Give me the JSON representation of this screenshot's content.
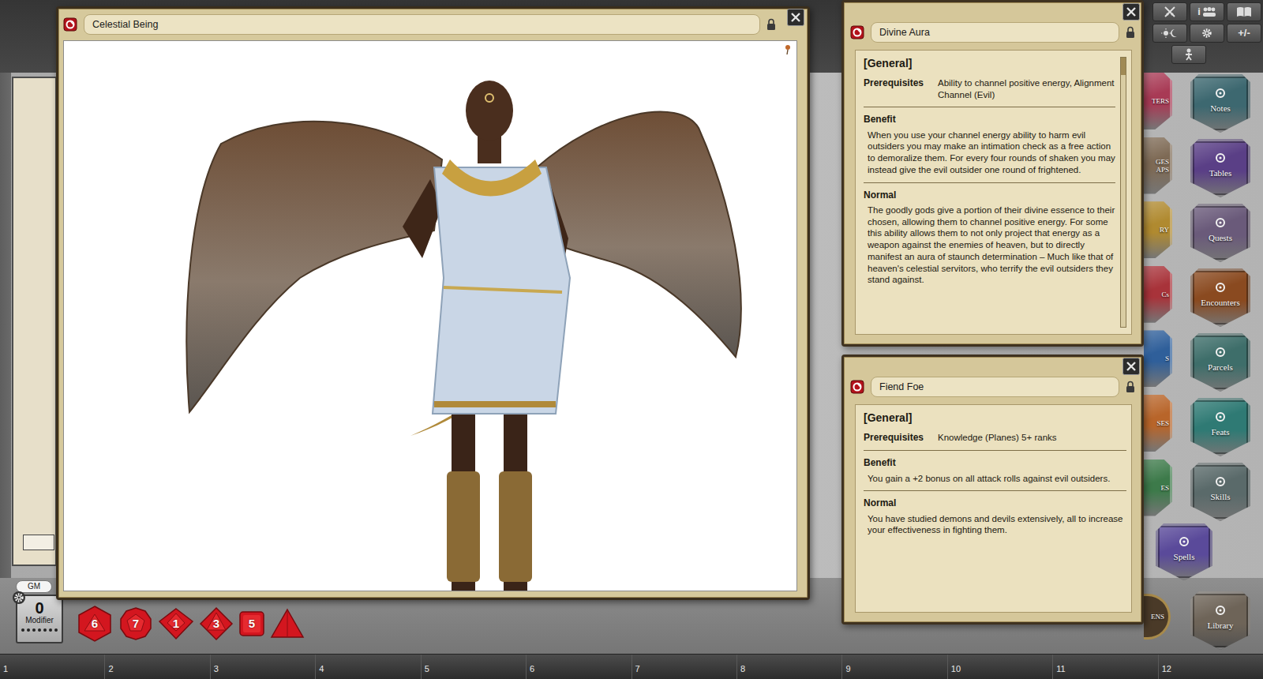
{
  "image_window": {
    "title": "Celestial Being"
  },
  "feat_windows": [
    {
      "title": "Divine Aura",
      "category": "[General]",
      "prerequisites_label": "Prerequisites",
      "prerequisites": "Ability to channel positive energy, Alignment Channel (Evil)",
      "benefit_label": "Benefit",
      "benefit": "When you use your channel energy ability to harm evil outsiders you may make an intimation check as a free action to demoralize them. For every four rounds of shaken you may instead give the evil outsider one round of frightened.",
      "normal_label": "Normal",
      "normal": "The goodly gods give a portion of their divine essence to their chosen, allowing them to channel positive energy. For some this ability allows them to not only project that energy as a weapon against the enemies of heaven, but to directly manifest an aura of staunch determination – Much like that of heaven's celestial servitors, who terrify the evil outsiders they stand against.",
      "scrollable": true
    },
    {
      "title": "Fiend Foe",
      "category": "[General]",
      "prerequisites_label": "Prerequisites",
      "prerequisites": "Knowledge (Planes) 5+ ranks",
      "benefit_label": "Benefit",
      "benefit": "You gain a +2 bonus on all attack rolls against evil outsiders.",
      "normal_label": "Normal",
      "normal": "You have studied demons and devils extensively, all to increase your effectiveness in fighting them.",
      "scrollable": false
    }
  ],
  "toolbar": {
    "info_label": "i",
    "modifier_toggle": "+/-"
  },
  "sidebar": {
    "left_column": [
      {
        "label": "TERS",
        "kind": "stub",
        "color": "#a83a55"
      },
      {
        "label": "GES\nAPS",
        "kind": "stub",
        "color": "#7e6a55"
      },
      {
        "label": "RY",
        "kind": "stub",
        "color": "#b08a30"
      },
      {
        "label": "Cs",
        "kind": "stub",
        "color": "#a8333a"
      },
      {
        "label": "S",
        "kind": "stub",
        "color": "#2f5f9a"
      },
      {
        "label": "SES",
        "kind": "stub",
        "color": "#b8652a"
      },
      {
        "label": "ES",
        "kind": "stub",
        "color": "#3d7a4a"
      },
      {
        "label": "Spells",
        "kind": "full",
        "color": "#5a4a9a"
      },
      {
        "label": "ENS",
        "kind": "round",
        "color": "#4a3a28"
      }
    ],
    "right_column": [
      {
        "label": "Notes",
        "color": "#3d6870"
      },
      {
        "label": "Tables",
        "color": "#5a3f86"
      },
      {
        "label": "Quests",
        "color": "#6a5a7a"
      },
      {
        "label": "Encounters",
        "color": "#8a4a20"
      },
      {
        "label": "Parcels",
        "color": "#3e6e6a"
      },
      {
        "label": "Feats",
        "color": "#2f7a74"
      },
      {
        "label": "Skills",
        "color": "#5a6a6a"
      },
      {
        "label": "Library",
        "color": "#6e6458"
      }
    ]
  },
  "dice_tray": {
    "user_label": "GM",
    "modifier": {
      "value": "0",
      "label": "Modifier"
    },
    "dice": [
      {
        "kind": "d20",
        "face": "6"
      },
      {
        "kind": "d12",
        "face": "7"
      },
      {
        "kind": "d10",
        "face": "1"
      },
      {
        "kind": "d8",
        "face": "3"
      },
      {
        "kind": "d6",
        "face": "5"
      },
      {
        "kind": "d4"
      }
    ]
  },
  "hotkeys": [
    "1",
    "2",
    "3",
    "4",
    "5",
    "6",
    "7",
    "8",
    "9",
    "10",
    "11",
    "12"
  ]
}
